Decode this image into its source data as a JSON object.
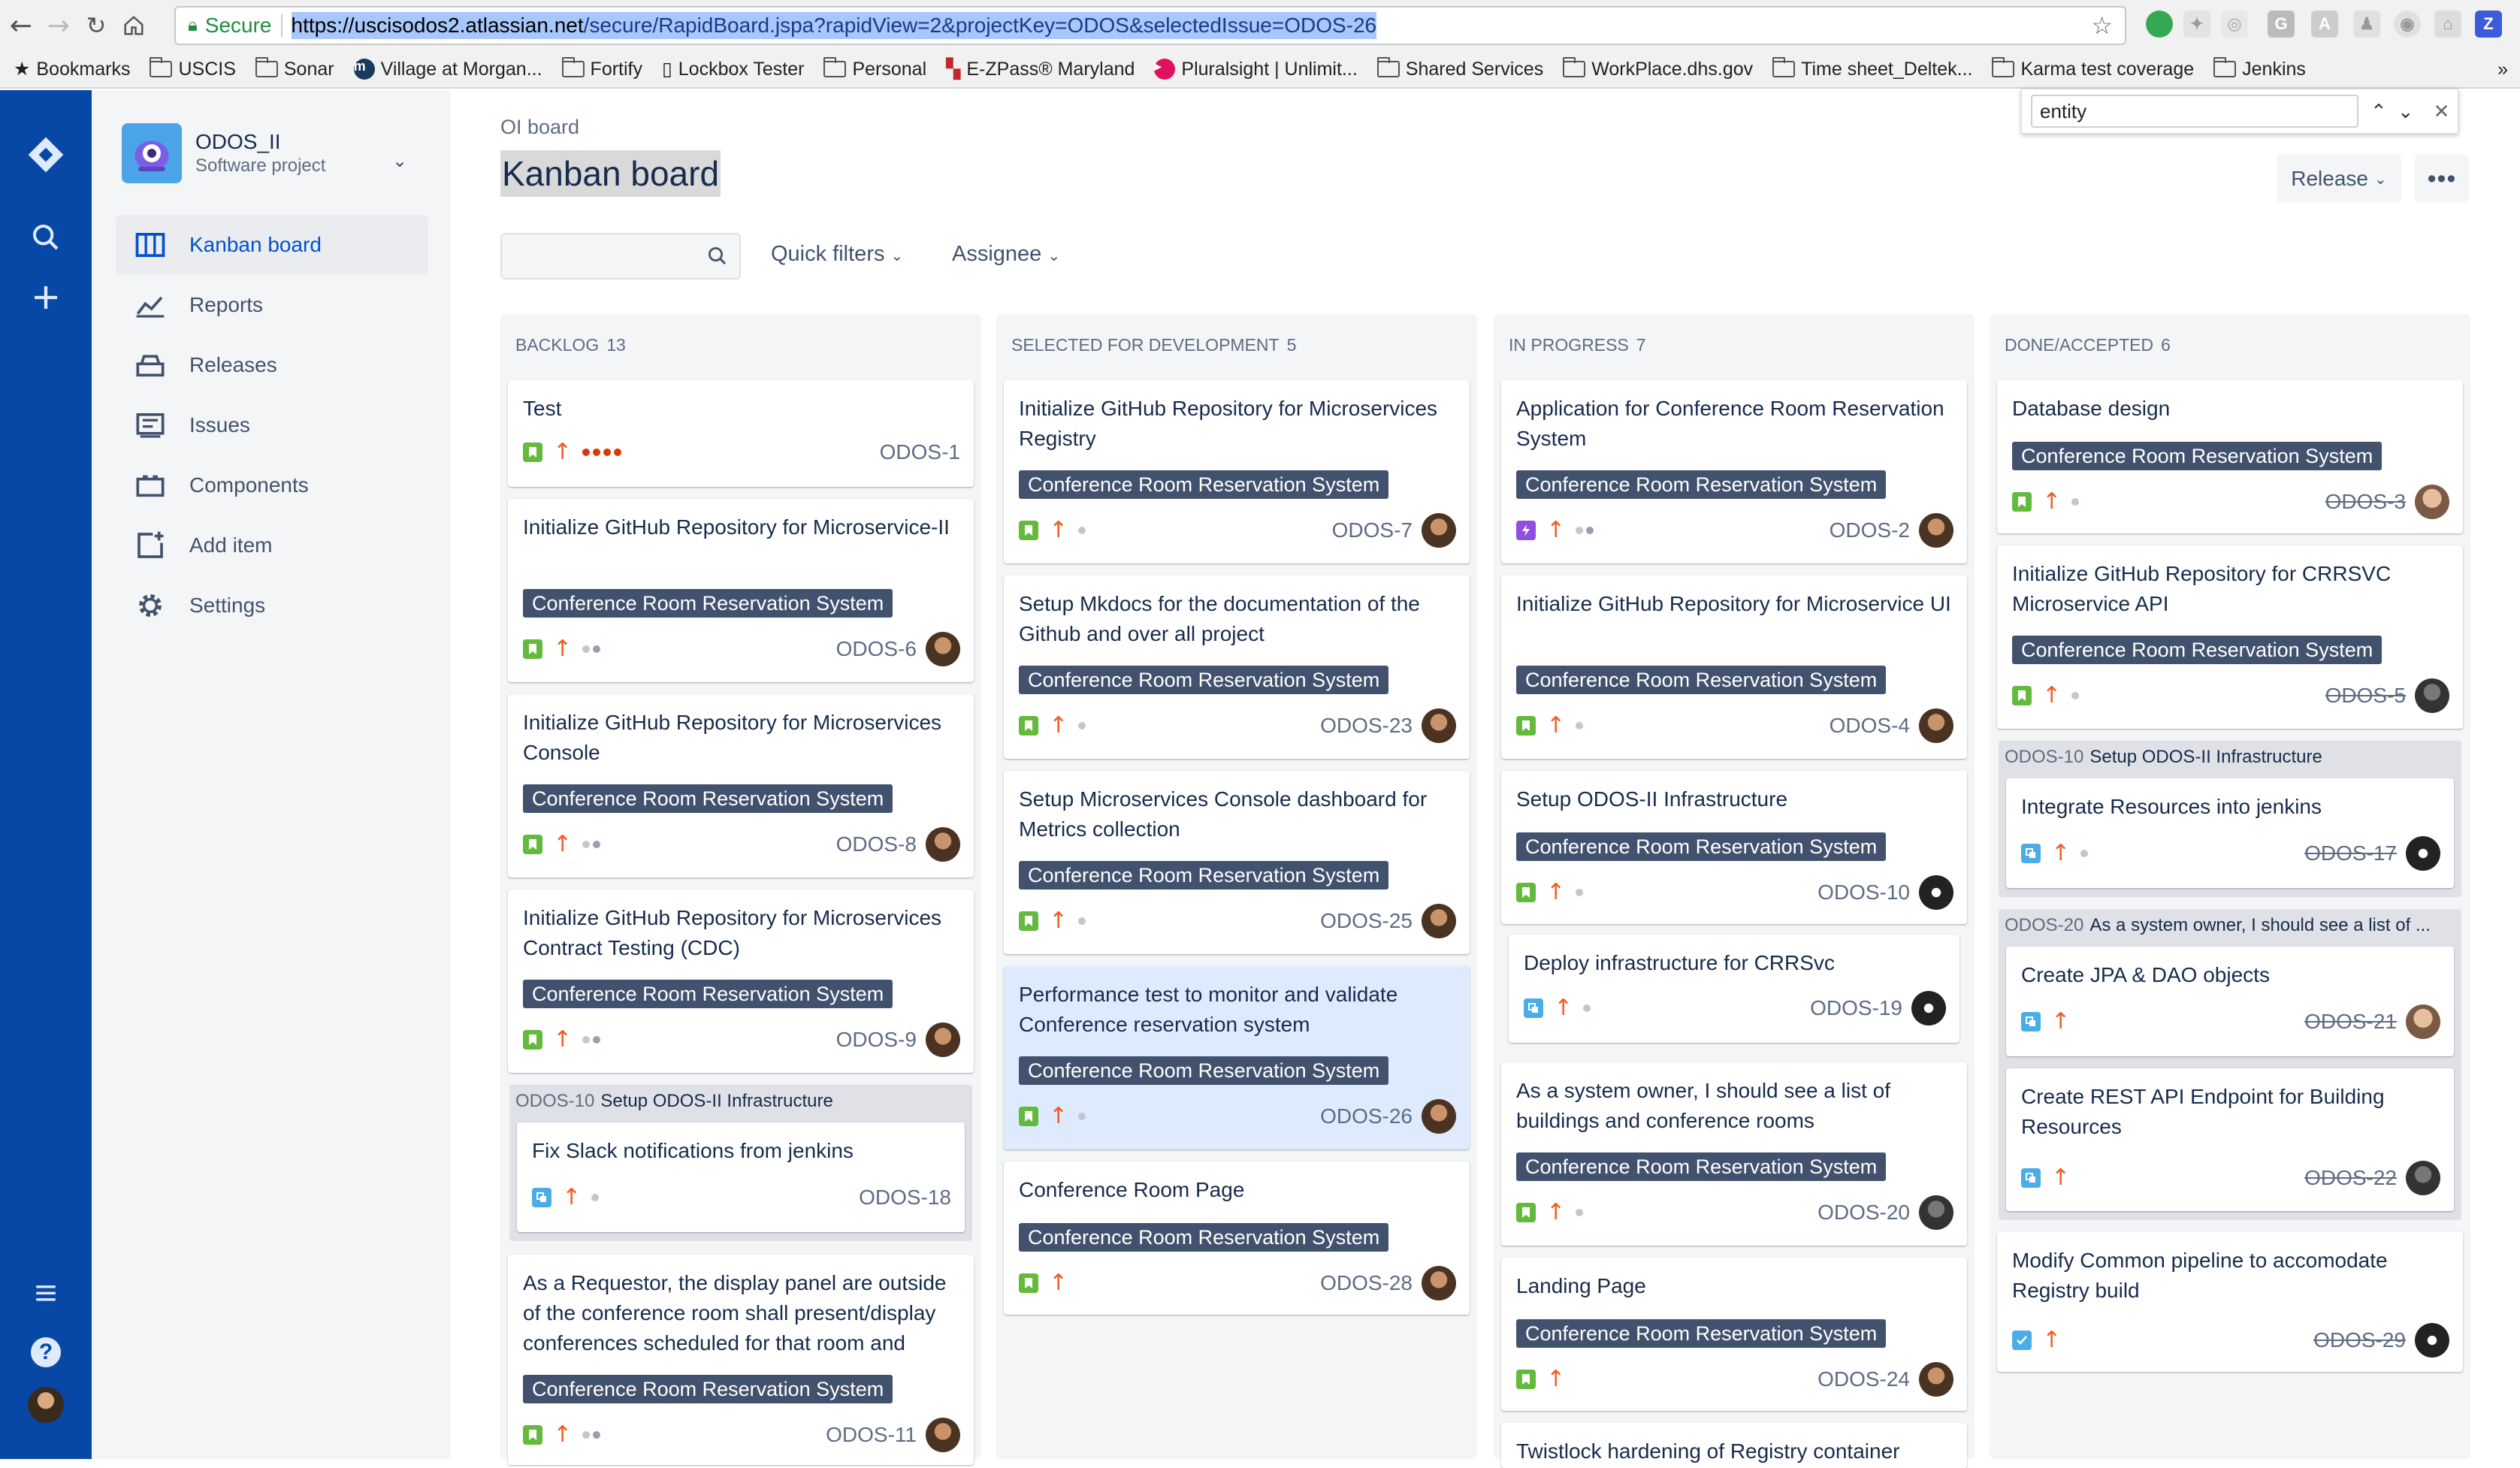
{
  "browser": {
    "secure_label": "Secure",
    "url_host": "https://uscisodos2.atlassian.net",
    "url_path": "/secure/RapidBoard.jspa?rapidView=2&projectKey=ODOS&selectedIssue=ODOS-26"
  },
  "bookmarks": [
    "Bookmarks",
    "USCIS",
    "Sonar",
    "Village at Morgan...",
    "Fortify",
    "Lockbox Tester",
    "Personal",
    "E-ZPass® Maryland",
    "Pluralsight | Unlimit...",
    "Shared Services",
    "WorkPlace.dhs.gov",
    "Time sheet_Deltek...",
    "Karma test coverage",
    "Jenkins"
  ],
  "find": {
    "query": "entity"
  },
  "project": {
    "name": "ODOS_II",
    "type": "Software project"
  },
  "sidebar": {
    "items": [
      {
        "label": "Kanban board",
        "icon": "board-icon"
      },
      {
        "label": "Reports",
        "icon": "reports-icon"
      },
      {
        "label": "Releases",
        "icon": "releases-icon"
      },
      {
        "label": "Issues",
        "icon": "issues-icon"
      },
      {
        "label": "Components",
        "icon": "components-icon"
      },
      {
        "label": "Add item",
        "icon": "add-item-icon"
      },
      {
        "label": "Settings",
        "icon": "gear-icon"
      }
    ]
  },
  "header": {
    "breadcrumb": "OI board",
    "title": "Kanban board",
    "release": "Release",
    "quick_filters": "Quick filters",
    "assignee": "Assignee"
  },
  "epic_label": "Conference Room Reservation System",
  "columns": [
    {
      "name": "BACKLOG",
      "count": "13",
      "cards": [
        {
          "title": "Test",
          "key": "ODOS-1"
        },
        {
          "title": "Initialize GitHub Repository for Microservice-II",
          "key": "ODOS-6"
        },
        {
          "title": "Initialize GitHub Repository for Microservices Console",
          "key": "ODOS-8"
        },
        {
          "title": "Initialize GitHub Repository for Microservices Contract Testing (CDC)",
          "key": "ODOS-9"
        },
        {
          "title": "Fix Slack notifications from jenkins",
          "key": "ODOS-18"
        },
        {
          "title": "As a Requestor, the display panel are outside of the conference room shall present/display conferences scheduled for that room and",
          "key": "ODOS-11"
        }
      ],
      "swimlane": {
        "key": "ODOS-10",
        "label": "Setup ODOS-II Infrastructure"
      }
    },
    {
      "name": "SELECTED FOR DEVELOPMENT",
      "count": "5",
      "cards": [
        {
          "title": "Initialize GitHub Repository for Microservices Registry",
          "key": "ODOS-7"
        },
        {
          "title": "Setup Mkdocs for the documentation of the Github and over all project",
          "key": "ODOS-23"
        },
        {
          "title": "Setup Microservices Console dashboard for Metrics collection",
          "key": "ODOS-25"
        },
        {
          "title": "Performance test to monitor and validate Conference reservation system",
          "key": "ODOS-26"
        },
        {
          "title": "Conference Room Page",
          "key": "ODOS-28"
        }
      ]
    },
    {
      "name": "IN PROGRESS",
      "count": "7",
      "cards": [
        {
          "title": "Application for Conference Room Reservation System",
          "key": "ODOS-2"
        },
        {
          "title": "Initialize GitHub Repository for Microservice UI",
          "key": "ODOS-4"
        },
        {
          "title": "Setup ODOS-II Infrastructure",
          "key": "ODOS-10"
        },
        {
          "title": "Deploy infrastructure for CRRSvc",
          "key": "ODOS-19"
        },
        {
          "title": "As a system owner, I should see a list of buildings and conference rooms",
          "key": "ODOS-20"
        },
        {
          "title": "Landing Page",
          "key": "ODOS-24"
        },
        {
          "title": "Twistlock hardening of Registry container",
          "key": ""
        }
      ]
    },
    {
      "name": "DONE/ACCEPTED",
      "count": "6",
      "cards": [
        {
          "title": "Database design",
          "key": "ODOS-3"
        },
        {
          "title": "Initialize GitHub Repository for CRRSVC Microservice API",
          "key": "ODOS-5"
        },
        {
          "title": "Integrate Resources into jenkins",
          "key": "ODOS-17"
        },
        {
          "title": "Create JPA & DAO objects",
          "key": "ODOS-21"
        },
        {
          "title": "Create REST API Endpoint for Building Resources",
          "key": "ODOS-22"
        },
        {
          "title": "Modify Common pipeline to accomodate Registry build",
          "key": "ODOS-29"
        }
      ],
      "swimlanes": [
        {
          "key": "ODOS-10",
          "label": "Setup ODOS-II Infrastructure"
        },
        {
          "key": "ODOS-20",
          "label": "As a system owner, I should see a list of ..."
        }
      ]
    }
  ],
  "colors": {
    "nav": "#0747a6",
    "epic": "#42526e",
    "story": "#63ba3c",
    "task": "#4bade8",
    "bug": "#904ee2",
    "priority": "#f15c22"
  }
}
